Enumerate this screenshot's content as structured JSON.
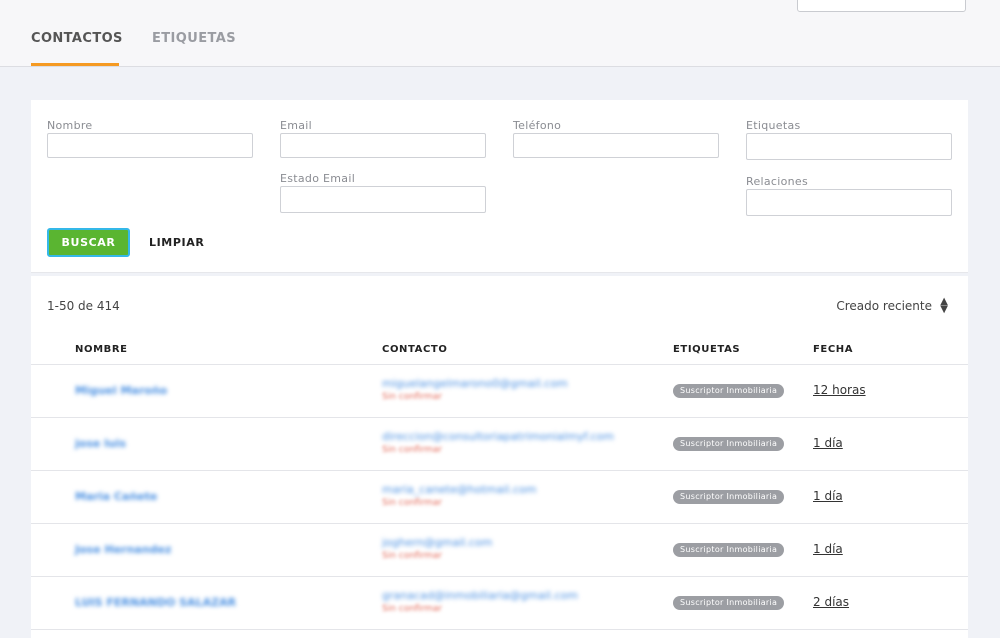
{
  "tabs": [
    {
      "label": "CONTACTOS",
      "active": true
    },
    {
      "label": "ETIQUETAS",
      "active": false
    }
  ],
  "accent_color": "#f59a23",
  "filters": {
    "nombre": {
      "label": "Nombre",
      "value": ""
    },
    "email": {
      "label": "Email",
      "value": ""
    },
    "telefono": {
      "label": "Teléfono",
      "value": ""
    },
    "etiquetas": {
      "label": "Etiquetas",
      "value": ""
    },
    "estado_email": {
      "label": "Estado Email",
      "value": ""
    },
    "relaciones": {
      "label": "Relaciones",
      "value": ""
    },
    "search_button": "BUSCAR",
    "clear_button": "LIMPIAR"
  },
  "results": {
    "count_text": "1-50 de 414",
    "sort_label": "Creado reciente",
    "columns": [
      "NOMBRE",
      "CONTACTO",
      "ETIQUETAS",
      "FECHA"
    ],
    "rows": [
      {
        "name": "Miguel Maroño",
        "email": "miguelangelmarono0@gmail.com",
        "status": "Sin confirmar",
        "tag": "Suscriptor Inmobiliaria",
        "date": "12 horas"
      },
      {
        "name": "jose luis",
        "email": "direccion@consultoriapatrimonialmyf.com",
        "status": "Sin confirmar",
        "tag": "Suscriptor Inmobiliaria",
        "date": "1 día"
      },
      {
        "name": "Maria Cañete",
        "email": "maria_canete@hotmail.com",
        "status": "Sin confirmar",
        "tag": "Suscriptor Inmobiliaria",
        "date": "1 día"
      },
      {
        "name": "Jose Hernandez",
        "email": "joghern@gmail.com",
        "status": "Sin confirmar",
        "tag": "Suscriptor Inmobiliaria",
        "date": "1 día"
      },
      {
        "name": "LUIS FERNANDO SALAZAR",
        "email": "granacad@inmobiliaria@gmail.com",
        "status": "Sin confirmar",
        "tag": "Suscriptor Inmobiliaria",
        "date": "2 días"
      }
    ]
  }
}
